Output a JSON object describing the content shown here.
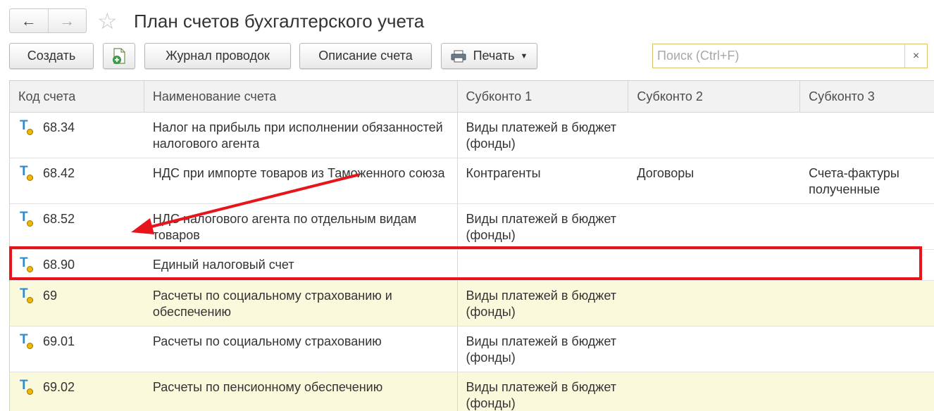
{
  "window": {
    "title": "План счетов бухгалтерского учета",
    "back_icon": "←",
    "forward_icon": "→",
    "favorite_icon": "☆"
  },
  "toolbar": {
    "create_label": "Создать",
    "journal_label": "Журнал проводок",
    "description_label": "Описание счета",
    "print_label": "Печать",
    "print_caret": "▼"
  },
  "search": {
    "placeholder": "Поиск (Ctrl+F)",
    "value": "",
    "clear_icon": "×"
  },
  "table": {
    "columns": [
      "Код счета",
      "Наименование счета",
      "Субконто 1",
      "Субконто 2",
      "Субконто 3"
    ],
    "rows": [
      {
        "code": "68.34",
        "name": "Налог на прибыль при исполнении обязанностей налогового агента",
        "sub1": "Виды платежей в бюджет (фонды)",
        "sub2": "",
        "sub3": "",
        "highlighted": false
      },
      {
        "code": "68.42",
        "name": "НДС при импорте товаров из Таможенного союза",
        "sub1": "Контрагенты",
        "sub2": "Договоры",
        "sub3": "Счета-фактуры полученные",
        "highlighted": false
      },
      {
        "code": "68.52",
        "name": "НДС налогового агента по отдельным видам товаров",
        "sub1": "Виды платежей в бюджет (фонды)",
        "sub2": "",
        "sub3": "",
        "highlighted": false
      },
      {
        "code": "68.90",
        "name": "Единый налоговый счет",
        "sub1": "",
        "sub2": "",
        "sub3": "",
        "highlighted": false
      },
      {
        "code": "69",
        "name": "Расчеты по социальному страхованию и обеспечению",
        "sub1": "Виды платежей в бюджет (фонды)",
        "sub2": "",
        "sub3": "",
        "highlighted": true
      },
      {
        "code": "69.01",
        "name": "Расчеты по социальному страхованию",
        "sub1": "Виды платежей в бюджет (фонды)",
        "sub2": "",
        "sub3": "",
        "highlighted": false
      },
      {
        "code": "69.02",
        "name": "Расчеты по пенсионному обеспечению",
        "sub1": "Виды платежей в бюджет (фонды)",
        "sub2": "",
        "sub3": "",
        "highlighted": true
      }
    ],
    "account_icon_letter": "T"
  },
  "colors": {
    "annotation": "#e8141b",
    "row_highlight": "#fbf9dc",
    "icon_blue": "#2e8bc9",
    "icon_dot": "#f1b800"
  }
}
